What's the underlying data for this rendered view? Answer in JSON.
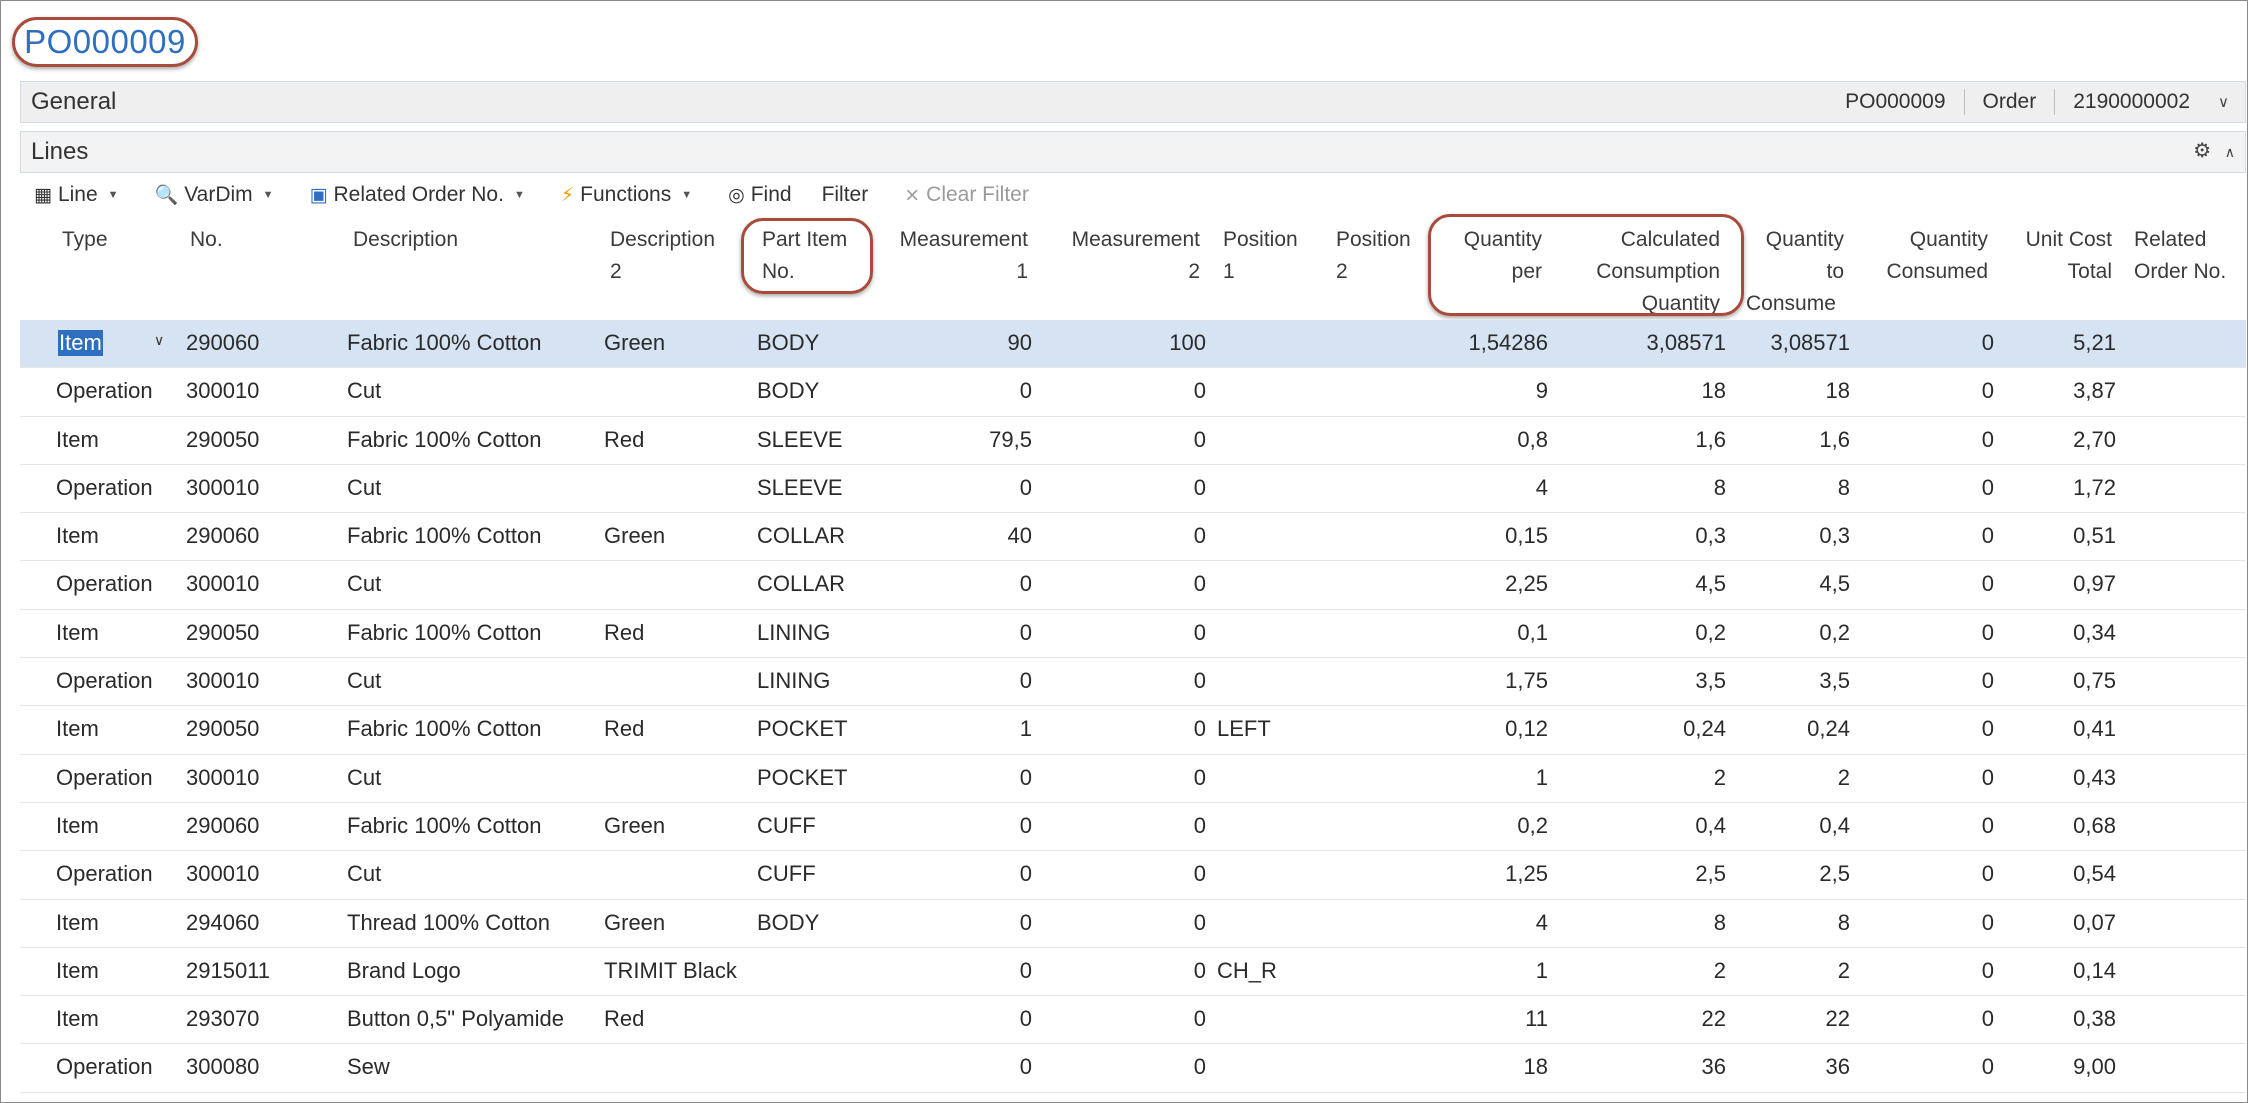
{
  "page_title": "PO000009",
  "general": {
    "label": "General",
    "summary": [
      "PO000009",
      "Order",
      "2190000002"
    ]
  },
  "lines": {
    "label": "Lines",
    "toolbar": {
      "line": "Line",
      "vardim": "VarDim",
      "related_order": "Related Order No.",
      "functions": "Functions",
      "find": "Find",
      "filter": "Filter",
      "clear_filter": "Clear Filter"
    },
    "columns": {
      "type": "Type",
      "no": "No.",
      "description": "Description",
      "description2": [
        "Description",
        "2"
      ],
      "part_item_no": [
        "Part Item",
        "No."
      ],
      "measurement1": [
        "Measurement",
        "1"
      ],
      "measurement2": [
        "Measurement",
        "2"
      ],
      "position1": [
        "Position",
        "1"
      ],
      "position2": [
        "Position",
        "2"
      ],
      "quantity_per": [
        "Quantity",
        "per"
      ],
      "calc_consumption": [
        "Calculated",
        "Consumption",
        "Quantity"
      ],
      "quantity_to_consume": [
        "Quantity",
        "to",
        "Consume"
      ],
      "quantity_consumed": [
        "Quantity",
        "Consumed"
      ],
      "unit_cost_total": [
        "Unit Cost",
        "Total"
      ],
      "related_order_no": [
        "Related",
        "Order No."
      ]
    },
    "rows": [
      {
        "type": "Item",
        "no": "290060",
        "description": "Fabric 100% Cotton",
        "description2": "Green",
        "part": "BODY",
        "m1": "90",
        "m2": "100",
        "pos1": "",
        "qty_per": "1,54286",
        "calc": "3,08571",
        "to_consume": "3,08571",
        "consumed": "0",
        "unit_cost": "5,21"
      },
      {
        "type": "Operation",
        "no": "300010",
        "description": "Cut",
        "description2": "",
        "part": "BODY",
        "m1": "0",
        "m2": "0",
        "pos1": "",
        "qty_per": "9",
        "calc": "18",
        "to_consume": "18",
        "consumed": "0",
        "unit_cost": "3,87"
      },
      {
        "type": "Item",
        "no": "290050",
        "description": "Fabric 100% Cotton",
        "description2": "Red",
        "part": "SLEEVE",
        "m1": "79,5",
        "m2": "0",
        "pos1": "",
        "qty_per": "0,8",
        "calc": "1,6",
        "to_consume": "1,6",
        "consumed": "0",
        "unit_cost": "2,70"
      },
      {
        "type": "Operation",
        "no": "300010",
        "description": "Cut",
        "description2": "",
        "part": "SLEEVE",
        "m1": "0",
        "m2": "0",
        "pos1": "",
        "qty_per": "4",
        "calc": "8",
        "to_consume": "8",
        "consumed": "0",
        "unit_cost": "1,72"
      },
      {
        "type": "Item",
        "no": "290060",
        "description": "Fabric 100% Cotton",
        "description2": "Green",
        "part": "COLLAR",
        "m1": "40",
        "m2": "0",
        "pos1": "",
        "qty_per": "0,15",
        "calc": "0,3",
        "to_consume": "0,3",
        "consumed": "0",
        "unit_cost": "0,51"
      },
      {
        "type": "Operation",
        "no": "300010",
        "description": "Cut",
        "description2": "",
        "part": "COLLAR",
        "m1": "0",
        "m2": "0",
        "pos1": "",
        "qty_per": "2,25",
        "calc": "4,5",
        "to_consume": "4,5",
        "consumed": "0",
        "unit_cost": "0,97"
      },
      {
        "type": "Item",
        "no": "290050",
        "description": "Fabric 100% Cotton",
        "description2": "Red",
        "part": "LINING",
        "m1": "0",
        "m2": "0",
        "pos1": "",
        "qty_per": "0,1",
        "calc": "0,2",
        "to_consume": "0,2",
        "consumed": "0",
        "unit_cost": "0,34"
      },
      {
        "type": "Operation",
        "no": "300010",
        "description": "Cut",
        "description2": "",
        "part": "LINING",
        "m1": "0",
        "m2": "0",
        "pos1": "",
        "qty_per": "1,75",
        "calc": "3,5",
        "to_consume": "3,5",
        "consumed": "0",
        "unit_cost": "0,75"
      },
      {
        "type": "Item",
        "no": "290050",
        "description": "Fabric 100% Cotton",
        "description2": "Red",
        "part": "POCKET",
        "m1": "1",
        "m2": "0",
        "pos1": "LEFT",
        "qty_per": "0,12",
        "calc": "0,24",
        "to_consume": "0,24",
        "consumed": "0",
        "unit_cost": "0,41"
      },
      {
        "type": "Operation",
        "no": "300010",
        "description": "Cut",
        "description2": "",
        "part": "POCKET",
        "m1": "0",
        "m2": "0",
        "pos1": "",
        "qty_per": "1",
        "calc": "2",
        "to_consume": "2",
        "consumed": "0",
        "unit_cost": "0,43"
      },
      {
        "type": "Item",
        "no": "290060",
        "description": "Fabric 100% Cotton",
        "description2": "Green",
        "part": "CUFF",
        "m1": "0",
        "m2": "0",
        "pos1": "",
        "qty_per": "0,2",
        "calc": "0,4",
        "to_consume": "0,4",
        "consumed": "0",
        "unit_cost": "0,68"
      },
      {
        "type": "Operation",
        "no": "300010",
        "description": "Cut",
        "description2": "",
        "part": "CUFF",
        "m1": "0",
        "m2": "0",
        "pos1": "",
        "qty_per": "1,25",
        "calc": "2,5",
        "to_consume": "2,5",
        "consumed": "0",
        "unit_cost": "0,54"
      },
      {
        "type": "Item",
        "no": "294060",
        "description": "Thread 100% Cotton",
        "description2": "Green",
        "part": "BODY",
        "m1": "0",
        "m2": "0",
        "pos1": "",
        "qty_per": "4",
        "calc": "8",
        "to_consume": "8",
        "consumed": "0",
        "unit_cost": "0,07"
      },
      {
        "type": "Item",
        "no": "2915011",
        "description": "Brand Logo",
        "description2": "TRIMIT Black",
        "part": "",
        "m1": "0",
        "m2": "0",
        "pos1": "CH_R",
        "qty_per": "1",
        "calc": "2",
        "to_consume": "2",
        "consumed": "0",
        "unit_cost": "0,14"
      },
      {
        "type": "Item",
        "no": "293070",
        "description": "Button 0,5\" Polyamide",
        "description2": "Red",
        "part": "",
        "m1": "0",
        "m2": "0",
        "pos1": "",
        "qty_per": "11",
        "calc": "22",
        "to_consume": "22",
        "consumed": "0",
        "unit_cost": "0,38"
      },
      {
        "type": "Operation",
        "no": "300080",
        "description": "Sew",
        "description2": "",
        "part": "",
        "m1": "0",
        "m2": "0",
        "pos1": "",
        "qty_per": "18",
        "calc": "36",
        "to_consume": "36",
        "consumed": "0",
        "unit_cost": "9,00"
      }
    ]
  },
  "colors": {
    "title": "#2f6fc0",
    "highlight_outline": "#a84a3c",
    "selected_row": "#d5e3f3"
  }
}
